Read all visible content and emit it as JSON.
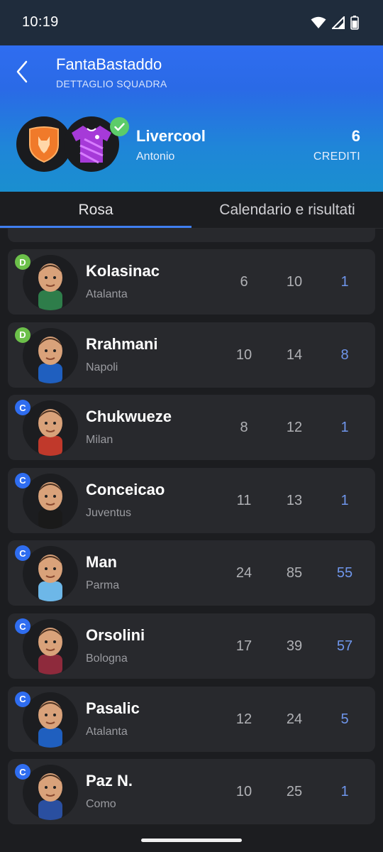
{
  "status": {
    "time": "10:19"
  },
  "header": {
    "league_title": "FantaBastaddo",
    "subtitle": "DETTAGLIO SQUADRA",
    "team_name": "Livercool",
    "owner": "Antonio",
    "credits_value": "6",
    "credits_label": "CREDITI"
  },
  "tabs": {
    "rosa": "Rosa",
    "calendar": "Calendario e risultati"
  },
  "colors": {
    "accent": "#2f6df0",
    "defender_badge": "#6cc04a",
    "midfielder_badge": "#2f6df0",
    "stat_highlight": "#6f96ec"
  },
  "players": [
    {
      "role": "D",
      "name": "Kolasinac",
      "club": "Atalanta",
      "stat1": "6",
      "stat2": "10",
      "stat3": "1"
    },
    {
      "role": "D",
      "name": "Rrahmani",
      "club": "Napoli",
      "stat1": "10",
      "stat2": "14",
      "stat3": "8"
    },
    {
      "role": "C",
      "name": "Chukwueze",
      "club": "Milan",
      "stat1": "8",
      "stat2": "12",
      "stat3": "1"
    },
    {
      "role": "C",
      "name": "Conceicao",
      "club": "Juventus",
      "stat1": "11",
      "stat2": "13",
      "stat3": "1"
    },
    {
      "role": "C",
      "name": "Man",
      "club": "Parma",
      "stat1": "24",
      "stat2": "85",
      "stat3": "55"
    },
    {
      "role": "C",
      "name": "Orsolini",
      "club": "Bologna",
      "stat1": "17",
      "stat2": "39",
      "stat3": "57"
    },
    {
      "role": "C",
      "name": "Pasalic",
      "club": "Atalanta",
      "stat1": "12",
      "stat2": "24",
      "stat3": "5"
    },
    {
      "role": "C",
      "name": "Paz N.",
      "club": "Como",
      "stat1": "10",
      "stat2": "25",
      "stat3": "1"
    }
  ]
}
